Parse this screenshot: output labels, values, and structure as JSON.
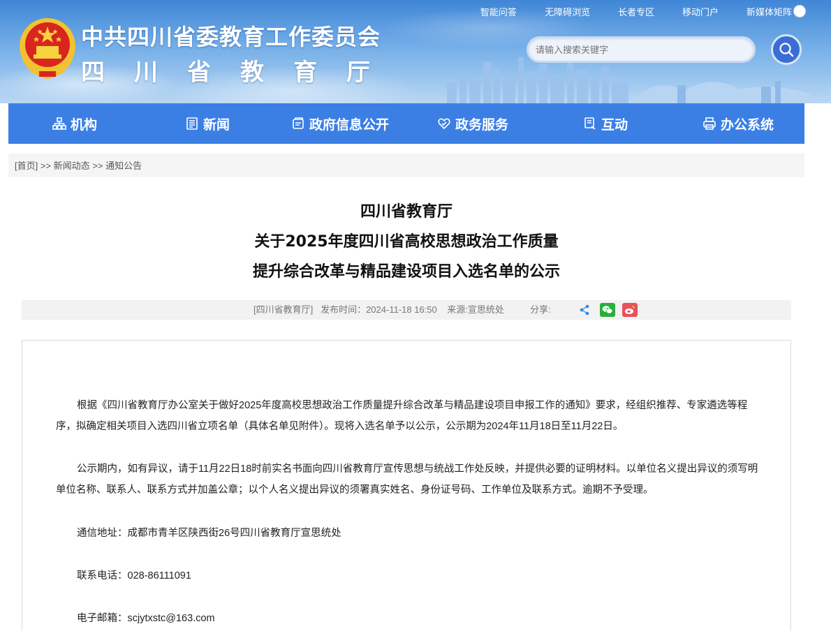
{
  "header": {
    "org_title": "中共四川省委教育工作委员会",
    "org_subtitle": "四川省教育厅",
    "top_links": [
      "智能问答",
      "无障碍浏览",
      "长者专区",
      "移动门户",
      "新媒体矩阵"
    ],
    "search": {
      "placeholder": "请输入搜索关键字"
    }
  },
  "nav": {
    "items": [
      {
        "label": "机构",
        "icon": "org-tree-icon"
      },
      {
        "label": "新闻",
        "icon": "news-icon"
      },
      {
        "label": "政府信息公开",
        "icon": "info-public-icon"
      },
      {
        "label": "政务服务",
        "icon": "service-icon"
      },
      {
        "label": "互动",
        "icon": "interaction-icon"
      },
      {
        "label": "办公系统",
        "icon": "office-system-icon"
      }
    ]
  },
  "breadcrumb": {
    "home": "[首页]",
    "sep": ">>",
    "level1": "新闻动态",
    "level2": "通知公告"
  },
  "article": {
    "title_line1": "四川省教育厅",
    "title_line2": "关于2025年度四川省高校思想政治工作质量",
    "title_line3": "提升综合改革与精品建设项目入选名单的公示",
    "meta_source_org": "[四川省教育厅]",
    "meta_publish": "发布时间：2024-11-18 16:50",
    "meta_origin": "来源:宣思统处",
    "share_label": "分享:",
    "paragraphs": [
      "根据《四川省教育厅办公室关于做好2025年度高校思想政治工作质量提升综合改革与精品建设项目申报工作的通知》要求，经组织推荐、专家遴选等程序，拟确定相关项目入选四川省立项名单（具体名单见附件）。现将入选名单予以公示，公示期为2024年11月18日至11月22日。",
      "公示期内，如有异议，请于11月22日18时前实名书面向四川省教育厅宣传思想与统战工作处反映，并提供必要的证明材料。以单位名义提出异议的须写明单位名称、联系人、联系方式并加盖公章；以个人名义提出异议的须署真实姓名、身份证号码、工作单位及联系方式。逾期不予受理。",
      "通信地址：成都市青羊区陕西街26号四川省教育厅宣思统处",
      "联系电话：028-86111091",
      "电子邮箱：scjytxstc@163.com"
    ]
  },
  "colors": {
    "nav_bg": "#3b7fe5",
    "wechat": "#2aae3c",
    "weibo": "#e8505b",
    "share": "#2d89e0"
  }
}
